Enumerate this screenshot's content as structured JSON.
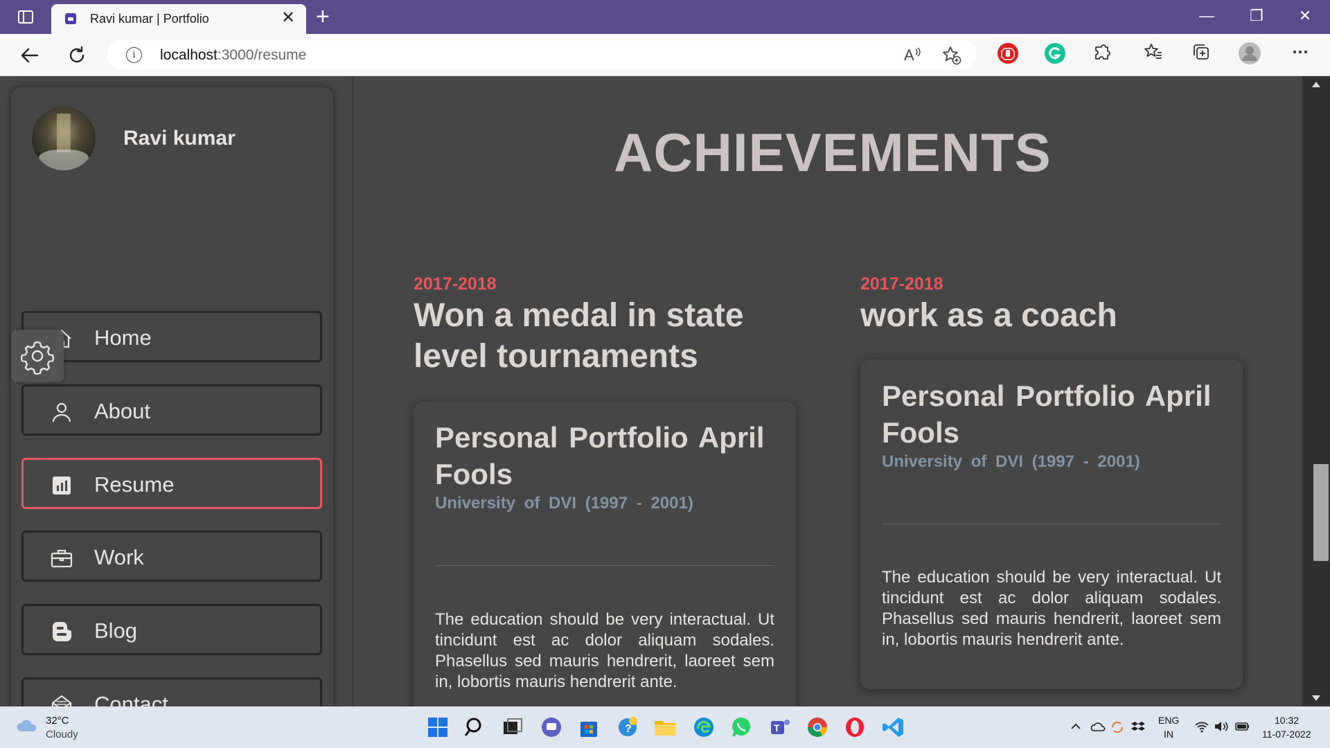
{
  "browser": {
    "tab_title": "Ravi kumar | Portfolio",
    "tab_close": "✕",
    "new_tab": "+",
    "url_host": "localhost",
    "url_path": ":3000/resume",
    "window_minimize": "—",
    "window_restore": "❐",
    "window_close": "✕"
  },
  "sidebar": {
    "name": "Ravi kumar",
    "items": [
      {
        "label": "Home",
        "icon": "home-icon"
      },
      {
        "label": "About",
        "icon": "user-icon"
      },
      {
        "label": "Resume",
        "icon": "bar-chart-icon",
        "active": true
      },
      {
        "label": "Work",
        "icon": "briefcase-icon"
      },
      {
        "label": "Blog",
        "icon": "blogger-icon"
      },
      {
        "label": "Contact",
        "icon": "mail-open-icon"
      }
    ]
  },
  "main": {
    "title": "ACHIEVEMENTS",
    "achievements": [
      {
        "year": "2017-2018",
        "title": "Won a medal in state level tournaments",
        "card_title": "Personal Portfolio April Fools",
        "card_subtitle": "University of DVI (1997 - 2001)",
        "card_body": "The education should be very interactual. Ut tincidunt est ac dolor aliquam sodales. Phasellus sed mauris hendrerit, laoreet sem in, lobortis mauris hendrerit ante."
      },
      {
        "year": "2017-2018",
        "title": "work as a coach",
        "card_title": "Personal Portfolio April Fools",
        "card_subtitle": "University of DVI (1997 - 2001)",
        "card_body": "The education should be very interactual. Ut tincidunt est ac dolor aliquam sodales. Phasellus sed mauris hendrerit, laoreet sem in, lobortis mauris hendrerit ante."
      }
    ]
  },
  "taskbar": {
    "temperature": "32°C",
    "condition": "Cloudy",
    "lang_line1": "ENG",
    "lang_line2": "IN",
    "time": "10:32",
    "date": "11-07-2022"
  },
  "colors": {
    "accent": "#e8555a",
    "titlebar": "#5b4b8a",
    "page_bg": "#464646"
  }
}
